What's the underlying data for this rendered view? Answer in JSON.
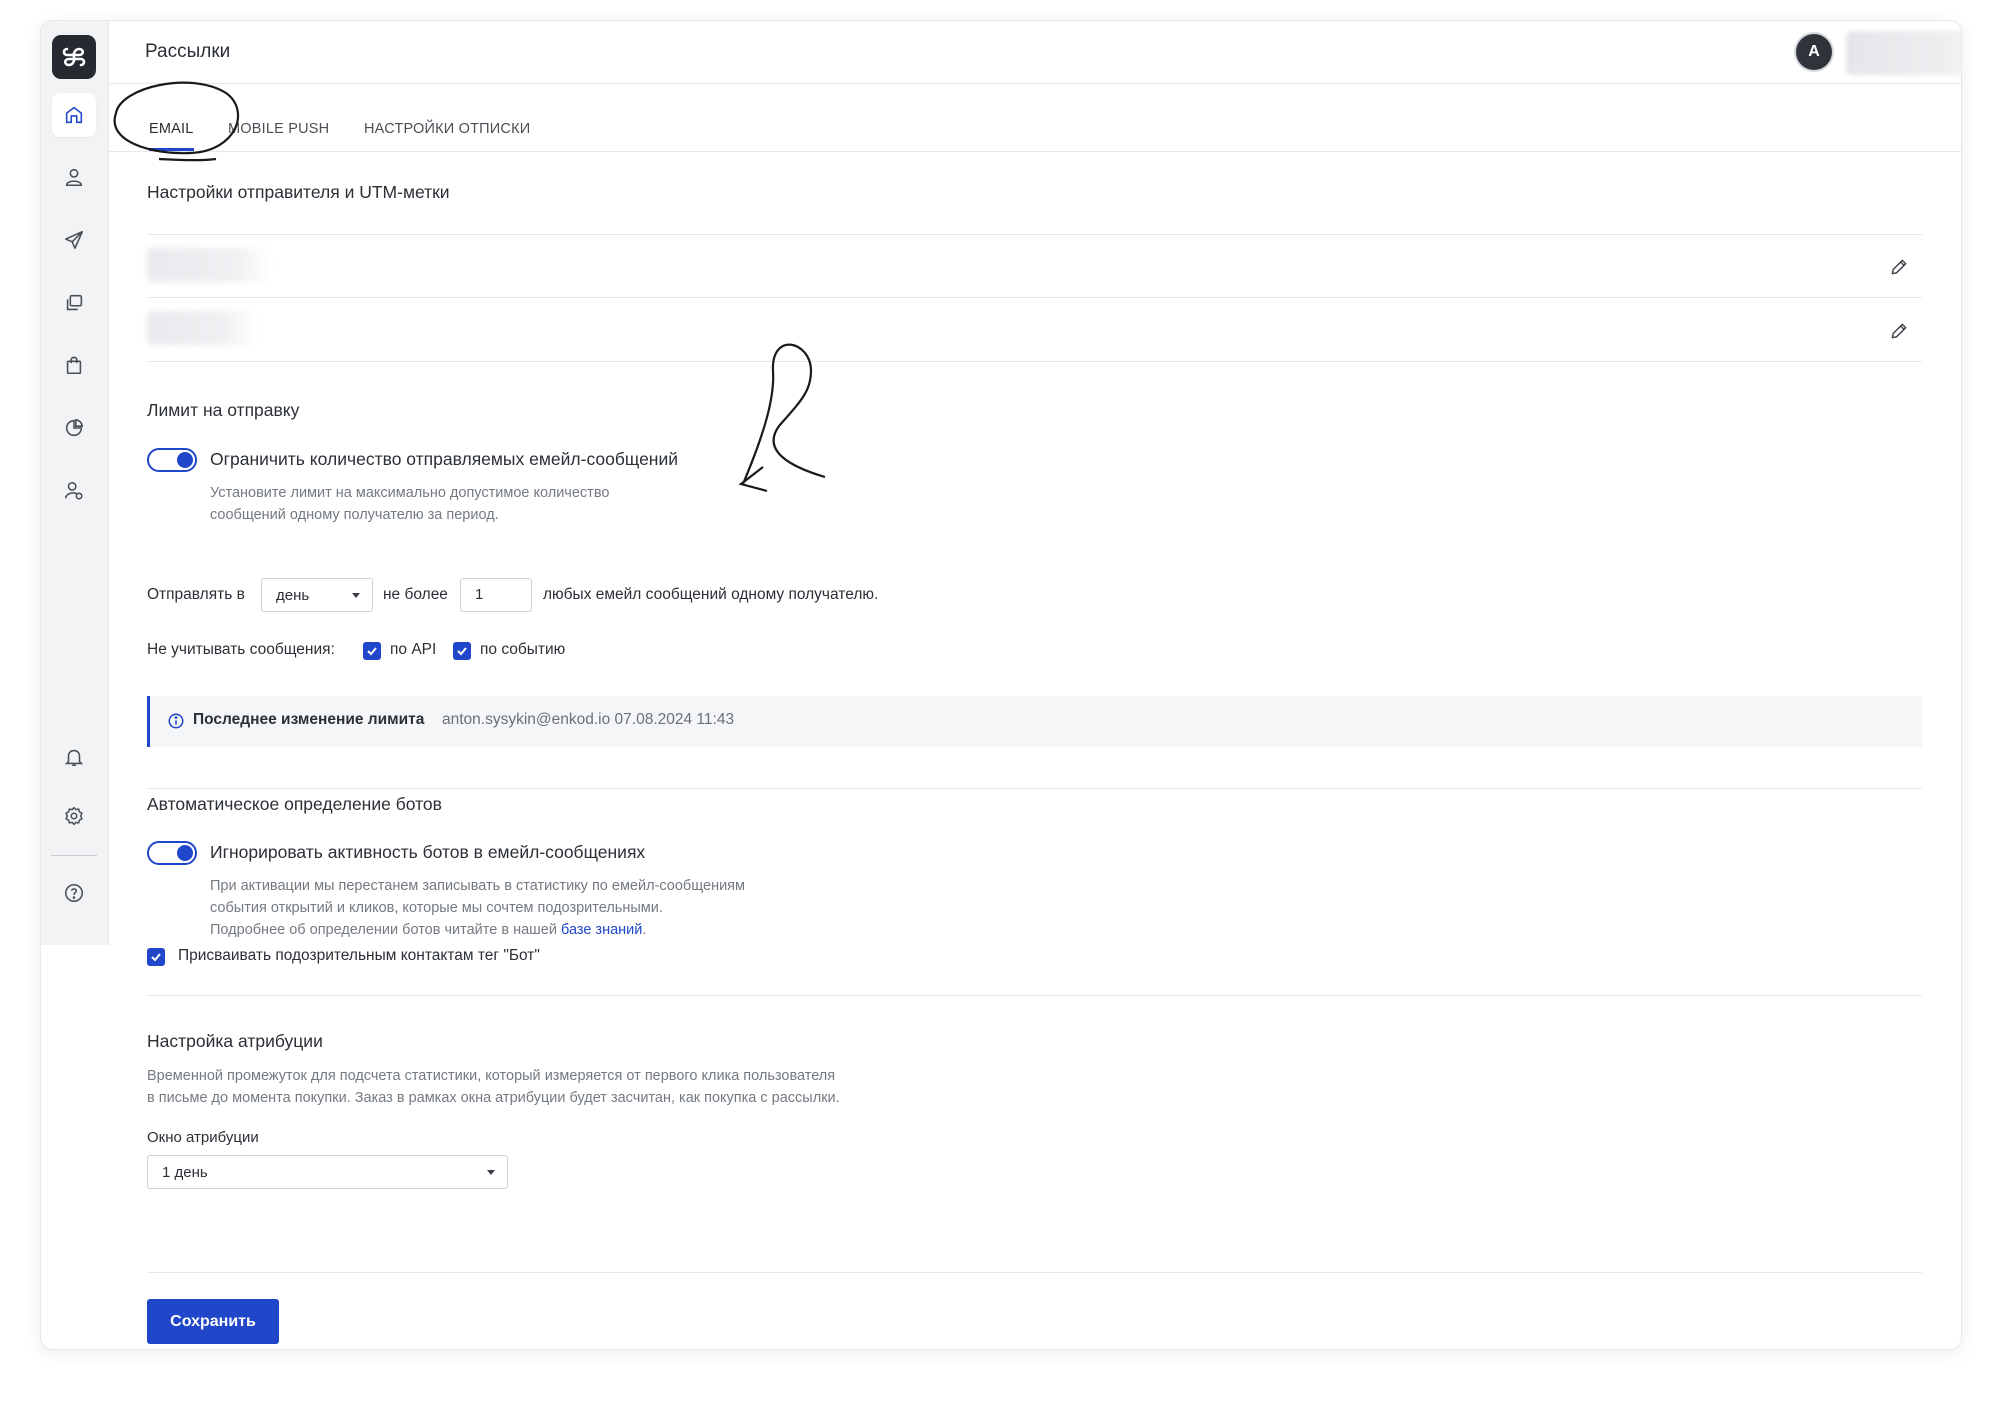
{
  "header": {
    "title": "Рассылки",
    "avatar_initial": "A"
  },
  "tabs": [
    {
      "label": "EMAIL",
      "active": true
    },
    {
      "label": "MOBILE PUSH",
      "active": false
    },
    {
      "label": "НАСТРОЙКИ ОТПИСКИ",
      "active": false
    }
  ],
  "sender": {
    "title": "Настройки отправителя и UTM-метки"
  },
  "limit": {
    "title": "Лимит на отправку",
    "toggle_label": "Ограничить количество отправляемых емейл-сообщений",
    "toggle_on": true,
    "hint_line1": "Установите лимит на максимально допустимое количество",
    "hint_line2": "сообщений одному получателю за период.",
    "send_in_label": "Отправлять в",
    "period_value": "день",
    "not_more_label": "не более",
    "count_value": "1",
    "suffix": "любых емейл сообщений одному получателю.",
    "ignore_label": "Не учитывать сообщения:",
    "by_api": "по API",
    "by_event": "по событию"
  },
  "info": {
    "bold": "Последнее изменение лимита",
    "meta": "anton.sysykin@enkod.io 07.08.2024 11:43"
  },
  "bots": {
    "title": "Автоматическое определение ботов",
    "toggle_label": "Игнорировать активность ботов в емейл-сообщениях",
    "toggle_on": true,
    "hint_line1": "При активации мы перестанем записывать в статистику по емейл-сообщениям",
    "hint_line2": "события открытий и кликов, которые мы сочтем подозрительными.",
    "hint_line3_prefix": "Подробнее об определении ботов читайте в нашей ",
    "hint_link": "базе знаний",
    "hint_line3_suffix": ".",
    "tag_checkbox_label": "Присваивать подозрительным контактам тег \"Бот\""
  },
  "attribution": {
    "title": "Настройка атрибуции",
    "desc_line1": "Временной промежуток для подсчета статистики, который измеряется от первого клика пользователя",
    "desc_line2": "в письме до момента покупки. Заказ в рамках окна атрибуции будет засчитан, как покупка с рассылки.",
    "window_label": "Окно атрибуции",
    "window_value": "1 день"
  },
  "save_label": "Сохранить",
  "colors": {
    "accent": "#2046c9",
    "sidebar": "#f2f3f5",
    "logo_bg": "#252a31"
  },
  "sidebar_icons": [
    "home-icon",
    "contacts-icon",
    "send-icon",
    "templates-icon",
    "shopping-bag-icon",
    "analytics-icon",
    "user-settings-icon",
    "bell-icon",
    "gear-icon",
    "help-icon"
  ]
}
